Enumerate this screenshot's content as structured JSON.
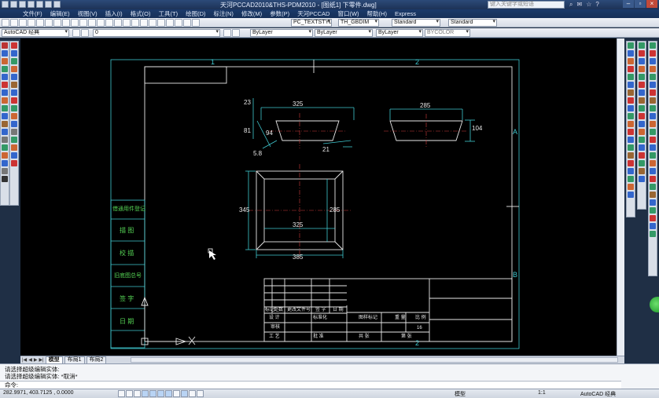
{
  "titlebar": {
    "title": "天河PCCAD2010&THS-PDM2010 - [图纸1] 下零件.dwg]",
    "search_placeholder": "键入关键字或短语"
  },
  "menu": [
    "文件(F)",
    "编辑(E)",
    "视图(V)",
    "插入(I)",
    "格式(O)",
    "工具(T)",
    "绘图(D)",
    "标注(N)",
    "修改(M)",
    "参数(P)",
    "天河PCCAD",
    "窗口(W)",
    "帮助(H)",
    "Express"
  ],
  "toolbar2": {
    "textstyle": "PC_TEXTSTYLE",
    "dimstyle": "TH_GBDIM",
    "tablestyle": "Standard",
    "mleaderstyle": "Standard"
  },
  "toolbar3": {
    "workspace": "AutoCAD 经典",
    "layer": "0",
    "color": "ByLayer",
    "linetype": "ByLayer",
    "lineweight": "ByLayer",
    "plotstyle": "BYCOLOR"
  },
  "drawing": {
    "zone_labels": {
      "top1": "1",
      "top2": "2",
      "right_a": "A",
      "right_b": "B",
      "bottom2": "2"
    },
    "dims_top_left": {
      "top": "325",
      "left1": "23",
      "left2": "81",
      "angle": "94",
      "bottom_left": "5.8",
      "bottom_right": "21"
    },
    "dims_top_right": {
      "top": "285",
      "right": "104"
    },
    "dims_plan": {
      "left": "345",
      "inner_width": "325",
      "inner_height": "285",
      "outer_width": "385"
    },
    "side_labels": [
      "借通用件登记",
      "描 图",
      "校 描",
      "旧底图总号",
      "签 字",
      "日 期"
    ],
    "title_block": {
      "row_labels": [
        "标记",
        "处数",
        "更改文件号",
        "签 字",
        "日 期"
      ],
      "design": "设 计",
      "standard": "标准化",
      "drawing_mark": "图样标记",
      "weight": "重 量",
      "ratio": "比 例",
      "scale_value": "16",
      "review": "审核",
      "process": "工 艺",
      "approve": "批 准",
      "total": "共 张",
      "sheet": "第 张"
    }
  },
  "tabs": [
    "模型",
    "布局1",
    "布局2"
  ],
  "command": {
    "line1": "请选择超级编辑实体:",
    "line2": "请选择超级编辑实体: *取消*",
    "prompt": "命令:"
  },
  "status": {
    "coords": "282.9971, 403.7125 , 0.0000",
    "model": "模型",
    "scale": "1:1",
    "workspace": "AutoCAD 经典"
  }
}
